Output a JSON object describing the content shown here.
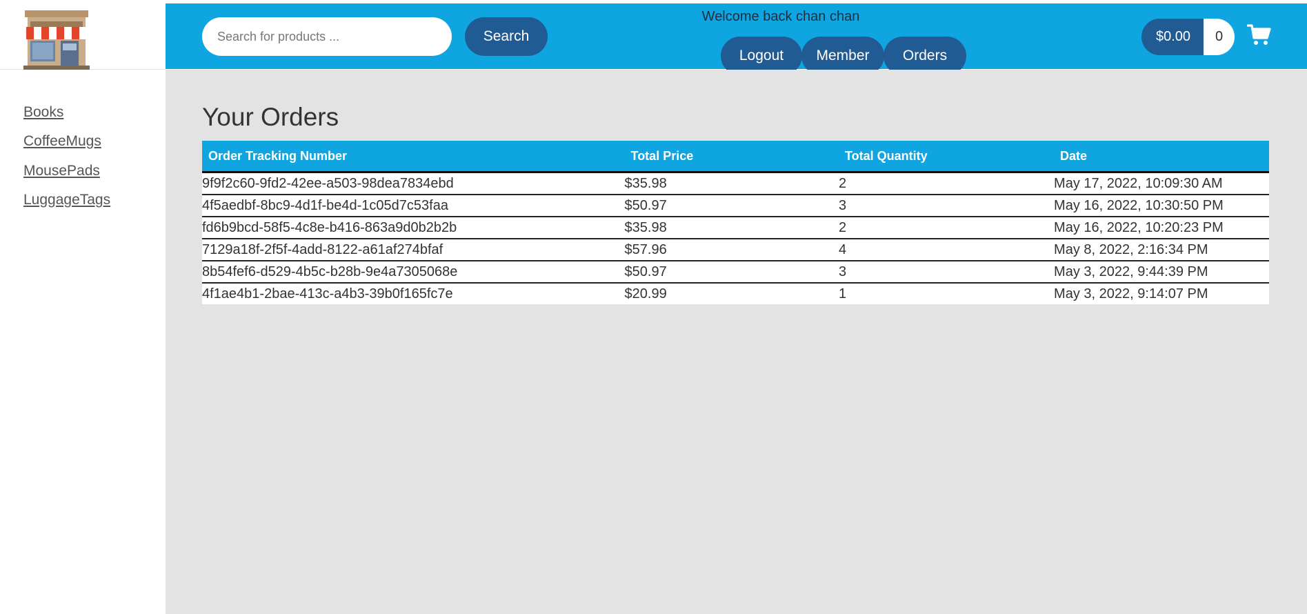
{
  "header": {
    "search_placeholder": "Search for products ...",
    "search_label": "Search",
    "welcome": "Welcome back chan chan",
    "logout_label": "Logout",
    "member_label": "Member",
    "orders_label": "Orders",
    "cart_total": "$0.00",
    "cart_count": "0",
    "cart_icon": "shopping-cart-icon",
    "logo_icon": "storefront-logo-icon"
  },
  "sidebar": {
    "items": [
      {
        "label": "Books"
      },
      {
        "label": "CoffeeMugs"
      },
      {
        "label": "MousePads"
      },
      {
        "label": "LuggageTags"
      }
    ]
  },
  "main": {
    "title": "Your Orders",
    "columns": [
      "Order Tracking Number",
      "Total Price",
      "Total Quantity",
      "Date"
    ],
    "rows": [
      {
        "tracking": "9f9f2c60-9fd2-42ee-a503-98dea7834ebd",
        "price": "$35.98",
        "quantity": "2",
        "date": "May 17, 2022, 10:09:30 AM"
      },
      {
        "tracking": "4f5aedbf-8bc9-4d1f-be4d-1c05d7c53faa",
        "price": "$50.97",
        "quantity": "3",
        "date": "May 16, 2022, 10:30:50 PM"
      },
      {
        "tracking": "fd6b9bcd-58f5-4c8e-b416-863a9d0b2b2b",
        "price": "$35.98",
        "quantity": "2",
        "date": "May 16, 2022, 10:20:23 PM"
      },
      {
        "tracking": "7129a18f-2f5f-4add-8122-a61af274bfaf",
        "price": "$57.96",
        "quantity": "4",
        "date": "May 8, 2022, 2:16:34 PM"
      },
      {
        "tracking": "8b54fef6-d529-4b5c-b28b-9e4a7305068e",
        "price": "$50.97",
        "quantity": "3",
        "date": "May 3, 2022, 9:44:39 PM"
      },
      {
        "tracking": "4f1ae4b1-2bae-413c-a4b3-39b0f165fc7e",
        "price": "$20.99",
        "quantity": "1",
        "date": "May 3, 2022, 9:14:07 PM"
      }
    ]
  },
  "colors": {
    "header_blue": "#0ea5e0",
    "button_navy": "#205b93",
    "main_bg": "#e3e3e3"
  }
}
